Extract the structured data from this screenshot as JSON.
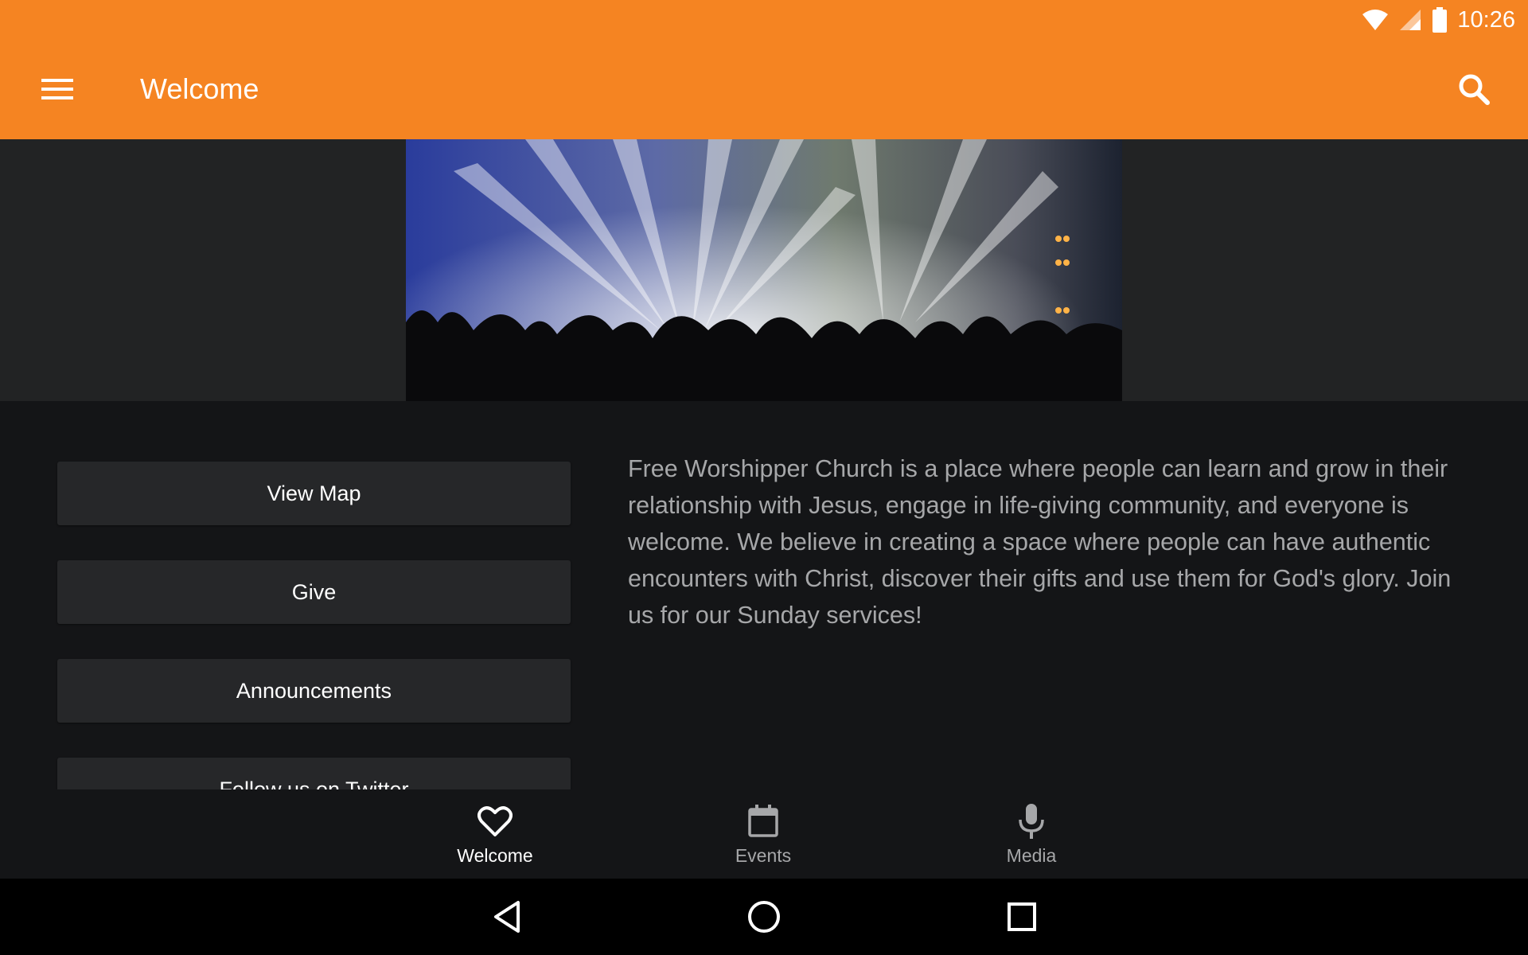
{
  "status_bar": {
    "time": "10:26",
    "icons": [
      "wifi-icon",
      "cell-signal-icon",
      "battery-icon"
    ]
  },
  "app_bar": {
    "title": "Welcome",
    "menu_icon": "hamburger-menu-icon",
    "search_icon": "search-icon",
    "color": "#F58422"
  },
  "buttons": [
    {
      "label": "View Map"
    },
    {
      "label": "Give"
    },
    {
      "label": "Announcements"
    },
    {
      "label": "Follow us on Twitter"
    }
  ],
  "description": "Free Worshipper Church is a place where people can learn and grow in their relationship with Jesus,  engage in life-giving community, and everyone is welcome. We believe in creating a space where people can have authentic encounters with Christ, discover their gifts and use them for God's glory. Join us for our Sunday services!",
  "bottom_nav": [
    {
      "label": "Welcome",
      "icon": "heart-icon",
      "active": true
    },
    {
      "label": "Events",
      "icon": "calendar-icon",
      "active": false
    },
    {
      "label": "Media",
      "icon": "microphone-icon",
      "active": false
    }
  ],
  "system_nav": [
    "back-icon",
    "home-icon",
    "recents-icon"
  ]
}
